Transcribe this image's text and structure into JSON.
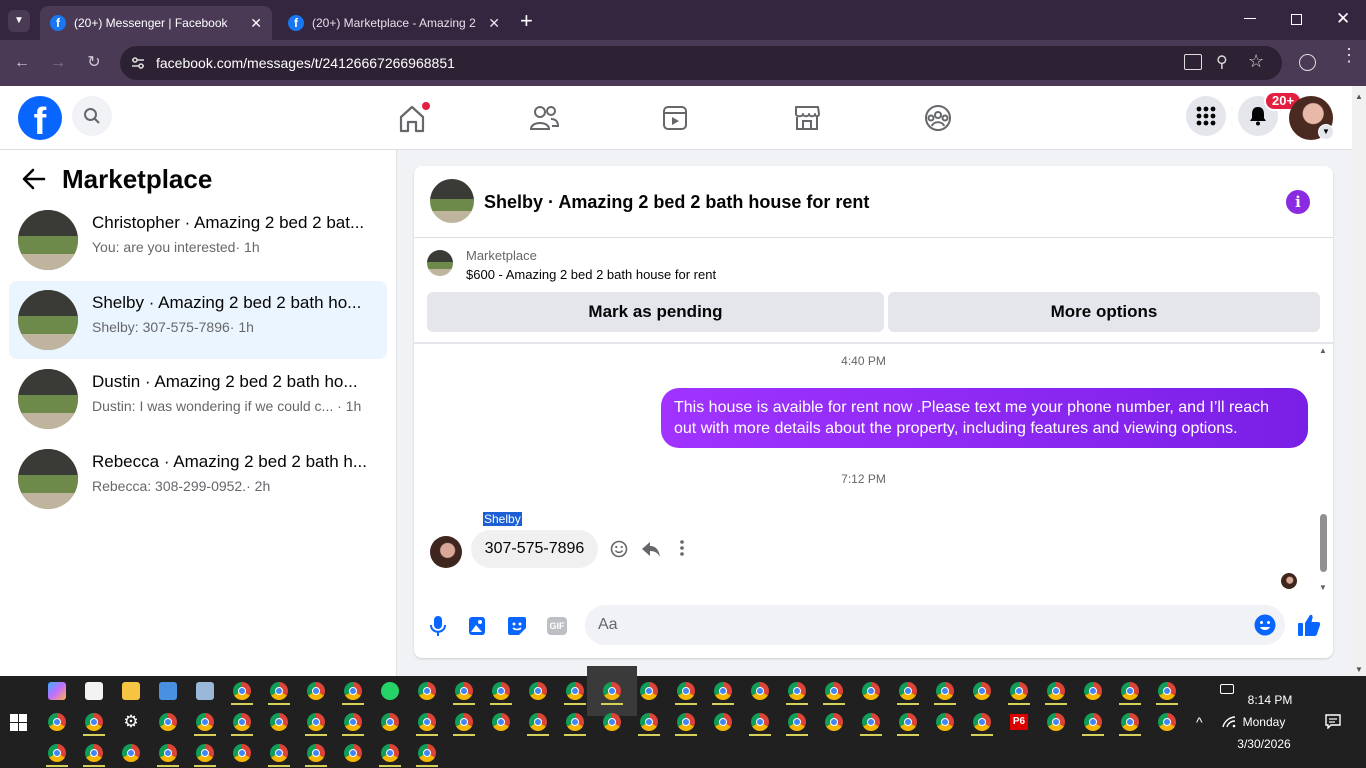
{
  "browser": {
    "tabs": [
      {
        "title": "(20+) Messenger | Facebook",
        "active": true
      },
      {
        "title": "(20+) Marketplace - Amazing 2",
        "active": false
      }
    ],
    "url": "facebook.com/messages/t/24126667266968851"
  },
  "fb_header": {
    "notification_badge": "20+"
  },
  "left_panel": {
    "title": "Marketplace",
    "conversations": [
      {
        "title": "Christopher · Amazing 2 bed 2 bat...",
        "preview": "You: are you interested",
        "time": "· 1h",
        "selected": false
      },
      {
        "title": "Shelby · Amazing 2 bed 2 bath ho...",
        "preview": "Shelby: 307-575-7896",
        "time": "· 1h",
        "selected": true
      },
      {
        "title": "Dustin · Amazing 2 bed 2 bath ho...",
        "preview": "Dustin: I was wondering if we could c...",
        "time": "· 1h",
        "selected": false
      },
      {
        "title": "Rebecca · Amazing 2 bed 2 bath h...",
        "preview": "Rebecca: 308-299-0952.",
        "time": "· 2h",
        "selected": false
      }
    ]
  },
  "chat": {
    "title": "Shelby · Amazing 2 bed 2 bath house for rent",
    "listing": {
      "source": "Marketplace",
      "summary": "$600 - Amazing 2 bed 2 bath house for rent"
    },
    "buttons": {
      "mark_pending": "Mark as pending",
      "more_options": "More options"
    },
    "messages": [
      {
        "time": "4:40 PM",
        "text": "This house is avaible for rent now .Please text me your phone number, and I’ll reach out with more details about the property, including features and viewing options.",
        "outgoing": true
      },
      {
        "time": "7:12 PM",
        "sender": "Shelby",
        "text": "307-575-7896",
        "outgoing": false
      }
    ],
    "composer_placeholder": "Aa",
    "gif_label": "GIF"
  },
  "taskbar": {
    "time": "8:14 PM",
    "day": "Monday",
    "date": "3/30/2026",
    "p6_label": "P6"
  },
  "colors": {
    "accent_purple": "#8a2be2",
    "fb_blue": "#1877f2",
    "selected_bg": "#ebf5ff",
    "badge_red": "#e41e3f"
  }
}
